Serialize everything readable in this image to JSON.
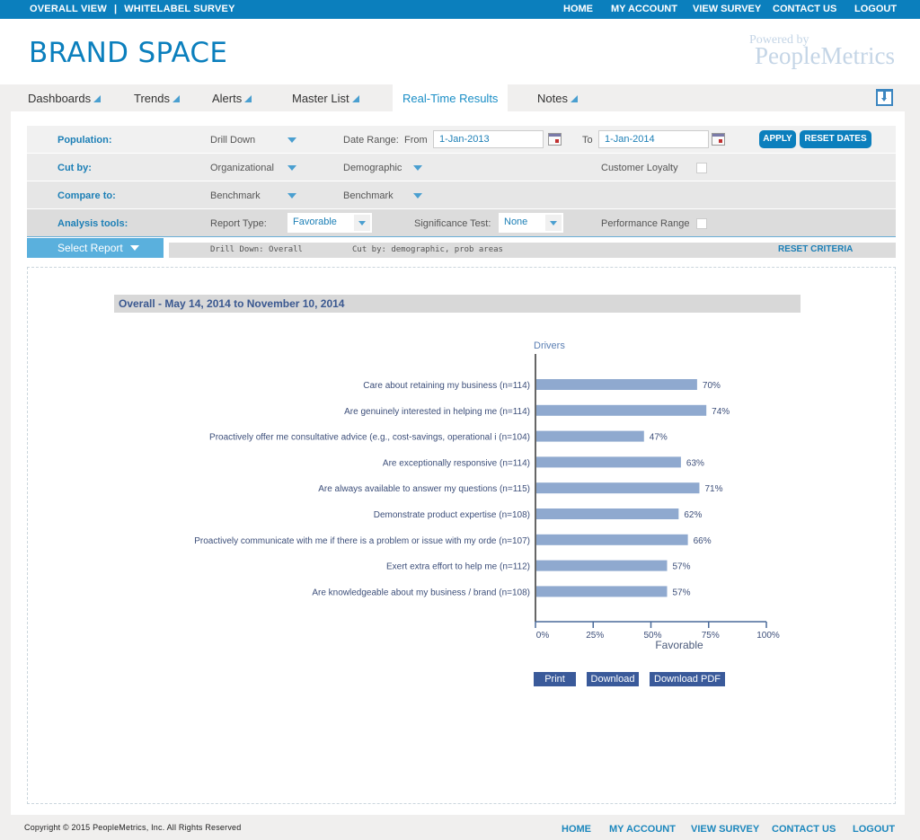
{
  "topbar": {
    "left": [
      "OVERALL VIEW",
      "WHITELABEL SURVEY"
    ],
    "separator": "|",
    "nav": [
      "HOME",
      "MY ACCOUNT",
      "VIEW SURVEY",
      "CONTACT US",
      "LOGOUT"
    ]
  },
  "header": {
    "brand": "BRAND SPACE",
    "powered_by": "Powered by",
    "powered_brand": "PeopleMetrics"
  },
  "tabs": [
    {
      "label": "Dashboards",
      "dropdown": true
    },
    {
      "label": "Trends",
      "dropdown": true
    },
    {
      "label": "Alerts",
      "dropdown": true
    },
    {
      "label": "Master List",
      "dropdown": true
    },
    {
      "label": "Real-Time Results",
      "dropdown": false,
      "active": true
    },
    {
      "label": "Notes",
      "dropdown": true
    }
  ],
  "filters": {
    "population": {
      "label": "Population:",
      "value": "Drill Down"
    },
    "date_range": {
      "label": "Date Range:",
      "from_label": "From",
      "from": "1-Jan-2013",
      "to_label": "To",
      "to": "1-Jan-2014"
    },
    "apply": "APPLY",
    "reset_dates": "RESET DATES",
    "cut_by": {
      "label": "Cut by:",
      "value1": "Organizational",
      "value2": "Demographic"
    },
    "customer_loyalty": {
      "label": "Customer Loyalty",
      "checked": false
    },
    "compare_to": {
      "label": "Compare to:",
      "value1": "Benchmark",
      "value2": "Benchmark"
    },
    "analysis_tools": {
      "label": "Analysis tools:"
    },
    "report_type": {
      "label": "Report Type:",
      "value": "Favorable"
    },
    "significance_test": {
      "label": "Significance Test:",
      "value": "None"
    },
    "performance_range": {
      "label": "Performance Range",
      "checked": false
    }
  },
  "report_bar": {
    "select_report": "Select Report",
    "criteria_drill": "Drill Down: Overall",
    "criteria_cut": "Cut by: demographic, prob areas",
    "reset_criteria": "RESET CRITERIA"
  },
  "report": {
    "title": "Overall  - May 14, 2014 to November 10, 2014",
    "buttons": [
      "Print",
      "Download",
      "Download PDF"
    ]
  },
  "chart_data": {
    "type": "bar",
    "orientation": "horizontal",
    "title": "Drivers",
    "xlabel": "Favorable",
    "ylabel": "",
    "xlim": [
      0,
      100
    ],
    "xticks": [
      "0%",
      "25%",
      "50%",
      "75%",
      "100%"
    ],
    "grid": false,
    "bar_color": "#8fa9cf",
    "categories": [
      "Care about retaining my business (n=114)",
      "Are genuinely interested in helping me (n=114)",
      "Proactively offer me consultative advice (e.g., cost-savings, operational i (n=104)",
      "Are exceptionally responsive (n=114)",
      "Are always available to answer my questions (n=115)",
      "Demonstrate product expertise (n=108)",
      "Proactively communicate with me if there is a problem or issue with my orde (n=107)",
      "Exert extra effort to help me (n=112)",
      "Are knowledgeable about my business / brand (n=108)"
    ],
    "values": [
      70,
      74,
      47,
      63,
      71,
      62,
      66,
      57,
      57
    ],
    "value_labels": [
      "70%",
      "74%",
      "47%",
      "63%",
      "71%",
      "62%",
      "66%",
      "57%",
      "57%"
    ]
  },
  "footer": {
    "copyright": "Copyright © 2015 PeopleMetrics, Inc. All Rights Reserved",
    "nav": [
      "HOME",
      "MY ACCOUNT",
      "VIEW SURVEY",
      "CONTACT US",
      "LOGOUT"
    ]
  }
}
